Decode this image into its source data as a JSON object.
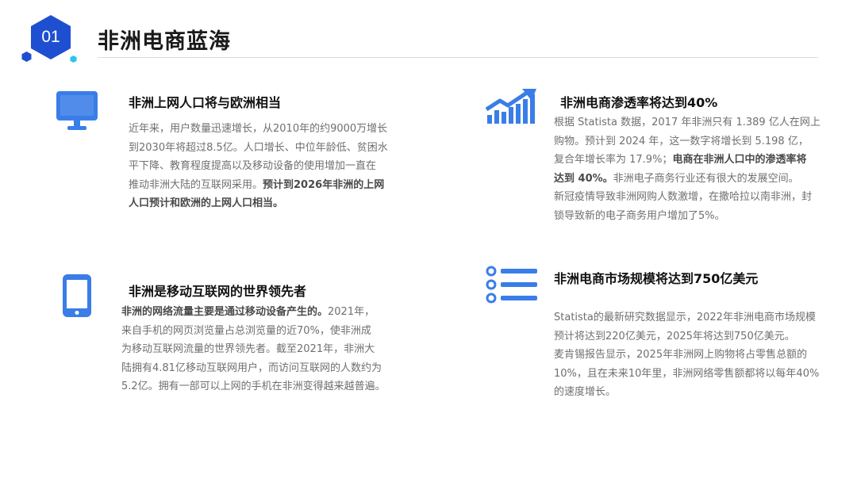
{
  "slide": {
    "number": "01",
    "title": "非洲电商蓝海",
    "accent_color": "#1f4fd1",
    "icon_color": "#3a7de8"
  },
  "sections": [
    {
      "icon": "monitor-icon",
      "heading": "非洲上网人口将与欧洲相当",
      "lines": [
        [
          {
            "t": "近年来，用户数量迅速增长，从2010年的约9000万增长"
          }
        ],
        [
          {
            "t": "到2030年将超过8.5亿。人口增长、中位年龄低、贫困水"
          }
        ],
        [
          {
            "t": "平下降、教育程度提高以及移动设备的使用增加一直在"
          }
        ],
        [
          {
            "t": "推动非洲大陆的互联网采用。"
          },
          {
            "t": "预计到2026年非洲的上网",
            "b": true
          }
        ],
        [
          {
            "t": "人口预计和欧洲的上网人口相当。",
            "b": true
          }
        ]
      ]
    },
    {
      "icon": "trend-chart-icon",
      "heading": "非洲电商渗透率将达到40%",
      "lines": [
        [
          {
            "t": "根据 Statista 数据，2017 年非洲只有 1.389 亿人在网上"
          }
        ],
        [
          {
            "t": "购物。预计到 2024 年，这一数字将增长到 5.198 亿，"
          }
        ],
        [
          {
            "t": "复合年增长率为 17.9%；"
          },
          {
            "t": "电商在非洲人口中的渗透率将",
            "b": true
          }
        ],
        [
          {
            "t": "达到 40%。",
            "b": true
          },
          {
            "t": "非洲电子商务行业还有很大的发展空间。"
          }
        ],
        [
          {
            "t": " "
          }
        ],
        [
          {
            "t": "新冠疫情导致非洲网购人数激增，在撒哈拉以南非洲，封"
          }
        ],
        [
          {
            "t": "锁导致新的电子商务用户增加了5%。"
          }
        ]
      ]
    },
    {
      "icon": "smartphone-icon",
      "heading": "非洲是移动互联网的世界领先者",
      "lines": [
        [
          {
            "t": "非洲的网络流量主要是通过移动设备产生的。",
            "b": true
          },
          {
            "t": "2021年，"
          }
        ],
        [
          {
            "t": "来自手机的网页浏览量占总浏览量的近70%，使非洲成"
          }
        ],
        [
          {
            "t": "为移动互联网流量的世界领先者。截至2021年，非洲大"
          }
        ],
        [
          {
            "t": "陆拥有4.81亿移动互联网用户，而访问互联网的人数约为"
          }
        ],
        [
          {
            "t": "5.2亿。拥有一部可以上网的手机在非洲变得越来越普遍。"
          }
        ]
      ]
    },
    {
      "icon": "list-icon",
      "heading": "非洲电商市场规模将达到750亿美元",
      "lines": [
        [
          {
            "t": "Statista的最新研究数据显示，2022年非洲电商市场规模"
          }
        ],
        [
          {
            "t": "预计将达到220亿美元，2025年将达到750亿美元。"
          }
        ],
        [
          {
            "t": " "
          }
        ],
        [
          {
            "t": "麦肯锡报告显示，2025年非洲网上购物将占零售总额的"
          }
        ],
        [
          {
            "t": "10%，且在未来10年里，非洲网络零售额都将以每年40%"
          }
        ],
        [
          {
            "t": "的速度增长。"
          }
        ]
      ]
    }
  ]
}
